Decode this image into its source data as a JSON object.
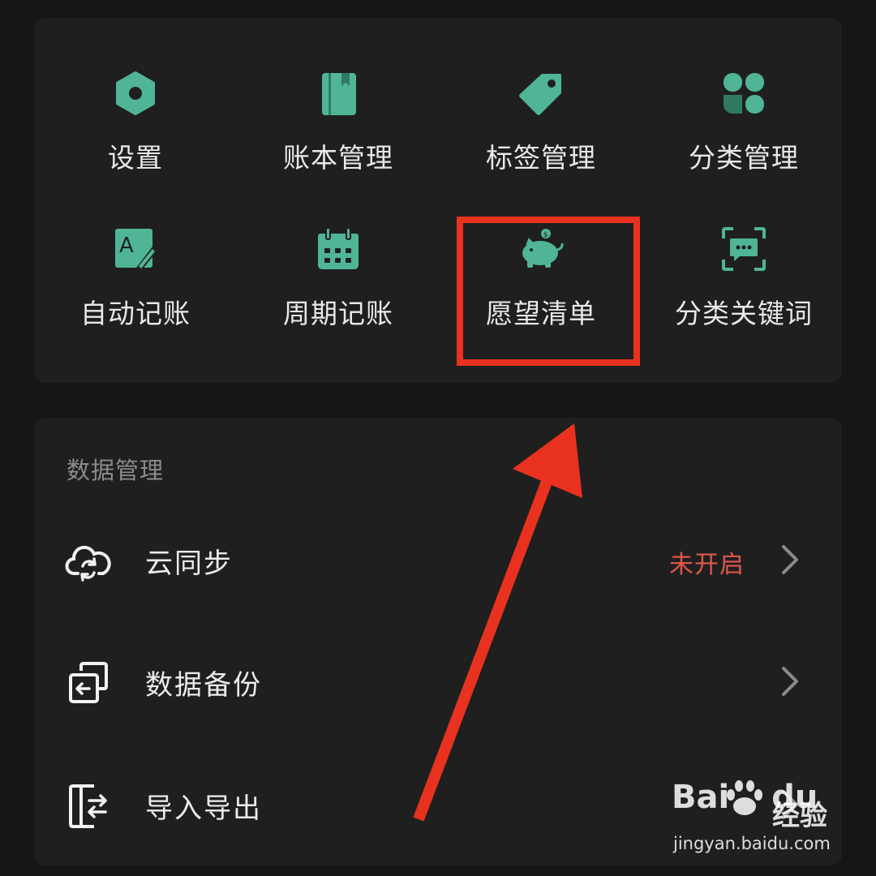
{
  "tools": {
    "items": [
      {
        "label": "设置",
        "icon": "settings-hex-icon"
      },
      {
        "label": "账本管理",
        "icon": "ledger-book-icon"
      },
      {
        "label": "标签管理",
        "icon": "tag-icon"
      },
      {
        "label": "分类管理",
        "icon": "category-grid-icon"
      },
      {
        "label": "自动记账",
        "icon": "auto-edit-icon"
      },
      {
        "label": "周期记账",
        "icon": "calendar-icon"
      },
      {
        "label": "愿望清单",
        "icon": "piggy-bank-icon"
      },
      {
        "label": "分类关键词",
        "icon": "keyword-chat-icon"
      }
    ]
  },
  "data_management": {
    "title": "数据管理",
    "rows": [
      {
        "label": "云同步",
        "status": "未开启",
        "icon": "cloud-sync-icon"
      },
      {
        "label": "数据备份",
        "status": "",
        "icon": "backup-icon"
      },
      {
        "label": "导入导出",
        "status": "",
        "icon": "import-export-icon"
      }
    ]
  },
  "watermark": {
    "logo_text": "Bai",
    "logo_text_2": "du",
    "brand_cn": "经验",
    "url": "jingyan.baidu.com"
  },
  "colors": {
    "accent_teal": "#4fb596",
    "status_red": "#e0574c",
    "annotation_red": "#e8321f",
    "card_bg": "#1f1f1f",
    "page_bg": "#161616"
  }
}
